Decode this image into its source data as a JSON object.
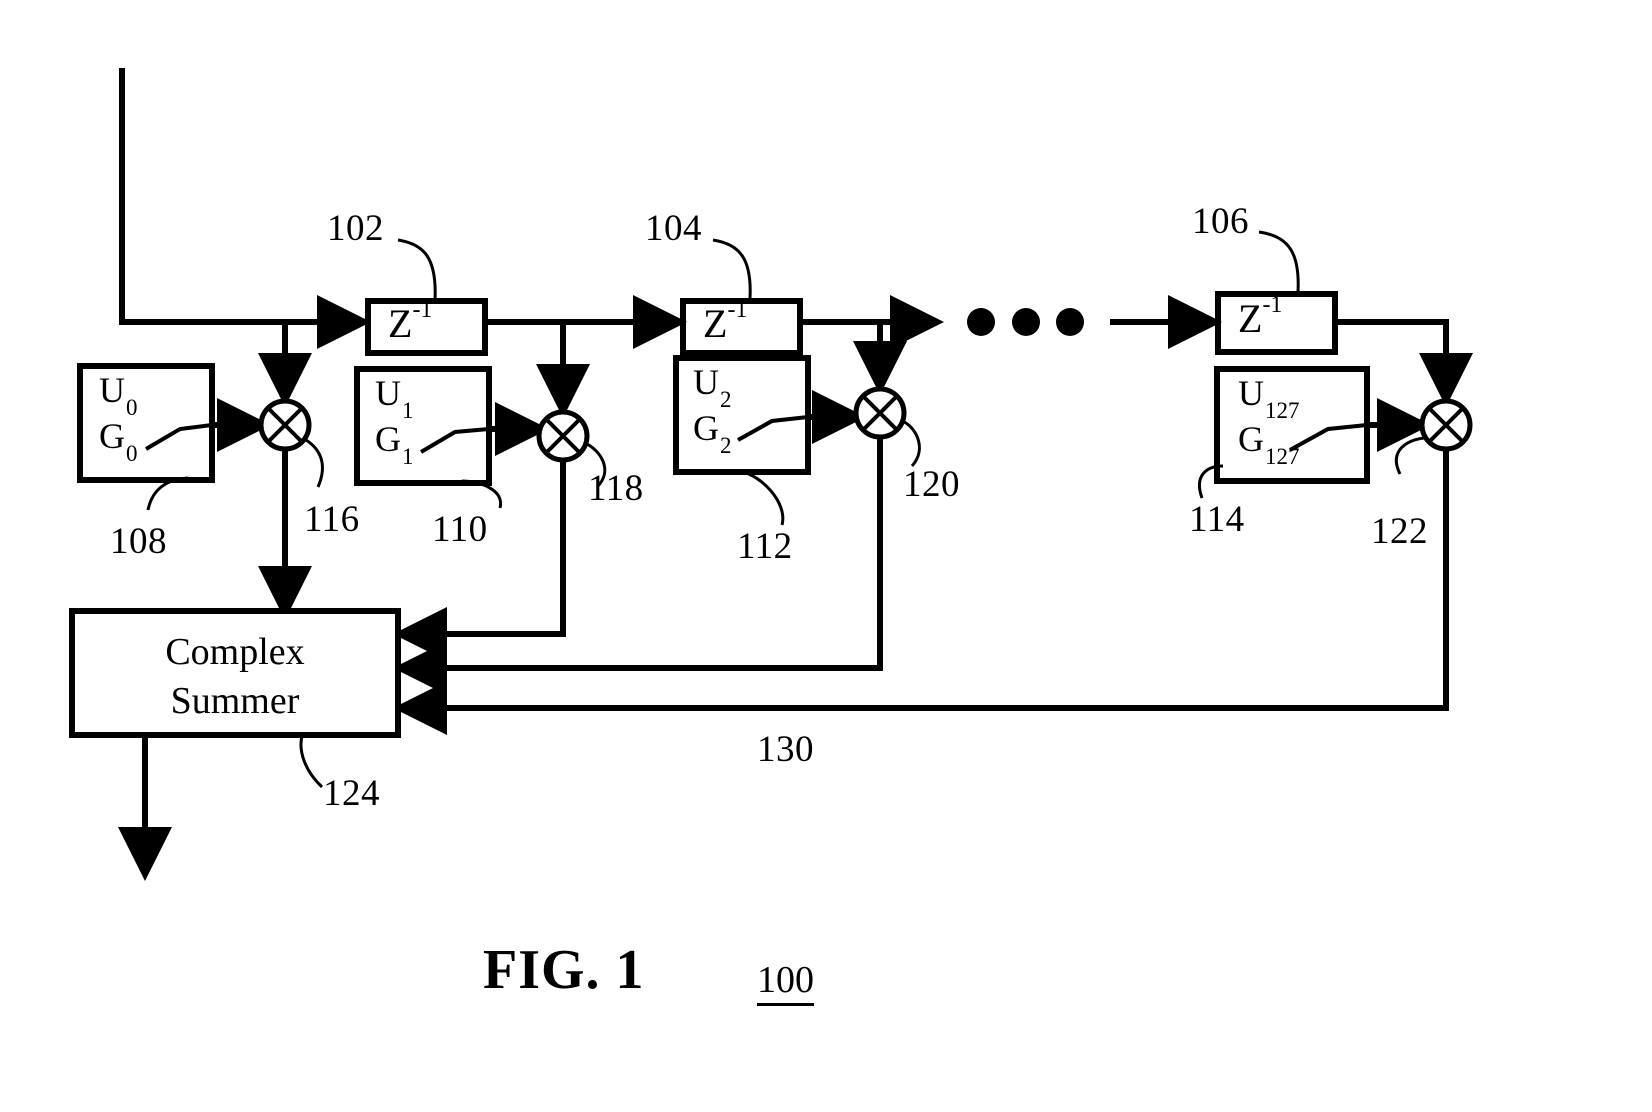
{
  "figure": {
    "title": "FIG. 1",
    "number": "100"
  },
  "blocks": {
    "delays": [
      {
        "label_z": "Z",
        "label_exp": "-1",
        "ref": "102"
      },
      {
        "label_z": "Z",
        "label_exp": "-1",
        "ref": "104"
      },
      {
        "label_z": "Z",
        "label_exp": "-1",
        "ref": "106"
      }
    ],
    "coefficients": [
      {
        "u": "U",
        "u_sub": "0",
        "g": "G",
        "g_sub": "0",
        "ref": "108"
      },
      {
        "u": "U",
        "u_sub": "1",
        "g": "G",
        "g_sub": "1",
        "ref": "110"
      },
      {
        "u": "U",
        "u_sub": "2",
        "g": "G",
        "g_sub": "2",
        "ref": "112"
      },
      {
        "u": "U",
        "u_sub": "127",
        "g": "G",
        "g_sub": "127",
        "ref": "114"
      }
    ],
    "multipliers": [
      {
        "symbol": "×",
        "ref": "116"
      },
      {
        "symbol": "×",
        "ref": "118"
      },
      {
        "symbol": "×",
        "ref": "120"
      },
      {
        "symbol": "×",
        "ref": "122"
      }
    ],
    "summer": {
      "line1": "Complex",
      "line2": "Summer",
      "ref": "124"
    },
    "feedback_bus": {
      "ref": "130"
    },
    "ellipsis": {
      "symbol": "•••",
      "dot_count": 3
    }
  },
  "colors": {
    "stroke": "#000000",
    "background": "#ffffff"
  }
}
